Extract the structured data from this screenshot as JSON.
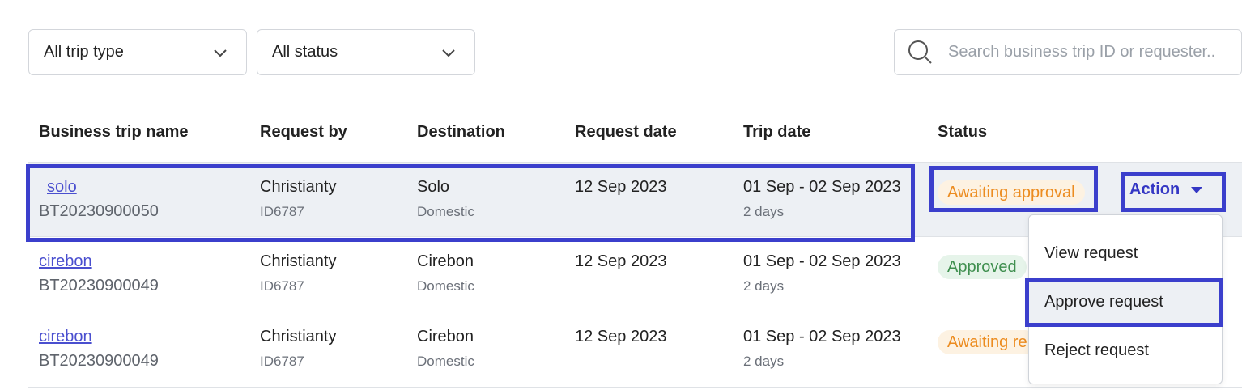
{
  "filters": {
    "trip_type": "All trip type",
    "status": "All status"
  },
  "search": {
    "placeholder": "Search business trip ID or requester.."
  },
  "table": {
    "headers": [
      "Business trip name",
      "Request by",
      "Destination",
      "Request date",
      "Trip date",
      "Status"
    ],
    "rows": [
      {
        "name": "solo",
        "code": "BT20230900050",
        "requester": "Christianty",
        "requester_id": "ID6787",
        "destination": "Solo",
        "destination_type": "Domestic",
        "request_date": "12 Sep 2023",
        "trip_date": "01 Sep - 02 Sep 2023",
        "duration": "2 days",
        "status": "Awaiting approval"
      },
      {
        "name": "cirebon",
        "code": "BT20230900049",
        "requester": "Christianty",
        "requester_id": "ID6787",
        "destination": "Cirebon",
        "destination_type": "Domestic",
        "request_date": "12 Sep 2023",
        "trip_date": "01 Sep - 02 Sep 2023",
        "duration": "2 days",
        "status": "Approved"
      },
      {
        "name": "cirebon",
        "code": "BT20230900049",
        "requester": "Christianty",
        "requester_id": "ID6787",
        "destination": "Cirebon",
        "destination_type": "Domestic",
        "request_date": "12 Sep 2023",
        "trip_date": "01 Sep - 02 Sep 2023",
        "duration": "2 days",
        "status": "Awaiting re"
      }
    ]
  },
  "action": {
    "label": "Action"
  },
  "menu": {
    "items": [
      "View request",
      "Approve request",
      "Reject request"
    ]
  },
  "colors": {
    "accent": "#3b3fcc",
    "awaiting": "#ec8c20",
    "approved": "#3f8f4f",
    "link": "#4a4fcf"
  },
  "icons": {
    "dropdown": "chevron-down-icon",
    "search": "search-icon",
    "action": "caret-down-icon"
  }
}
